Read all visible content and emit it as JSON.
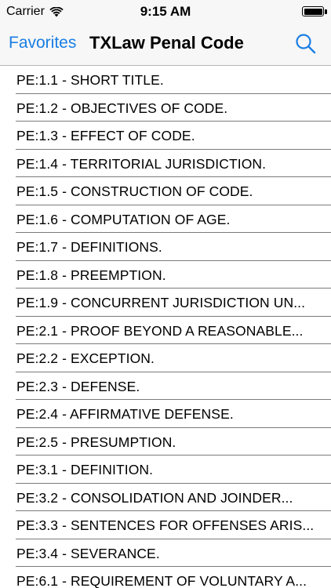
{
  "status_bar": {
    "carrier": "Carrier",
    "time": "9:15 AM",
    "wifi_icon": "wifi-icon",
    "battery_icon": "battery-icon"
  },
  "nav": {
    "back_label": "Favorites",
    "title": "TXLaw Penal Code",
    "search_icon": "search-icon",
    "accent_color": "#1a7ee3"
  },
  "list": {
    "items": [
      {
        "label": "PE:1.1 - SHORT TITLE."
      },
      {
        "label": "PE:1.2 - OBJECTIVES OF CODE."
      },
      {
        "label": "PE:1.3 - EFFECT OF CODE."
      },
      {
        "label": "PE:1.4 - TERRITORIAL JURISDICTION."
      },
      {
        "label": "PE:1.5 - CONSTRUCTION OF CODE."
      },
      {
        "label": "PE:1.6 - COMPUTATION OF AGE."
      },
      {
        "label": "PE:1.7 - DEFINITIONS."
      },
      {
        "label": "PE:1.8 - PREEMPTION."
      },
      {
        "label": "PE:1.9 - CONCURRENT JURISDICTION UN..."
      },
      {
        "label": "PE:2.1 - PROOF BEYOND A REASONABLE..."
      },
      {
        "label": "PE:2.2 - EXCEPTION."
      },
      {
        "label": "PE:2.3 - DEFENSE."
      },
      {
        "label": "PE:2.4 - AFFIRMATIVE DEFENSE."
      },
      {
        "label": "PE:2.5 - PRESUMPTION."
      },
      {
        "label": "PE:3.1 - DEFINITION."
      },
      {
        "label": "PE:3.2 - CONSOLIDATION AND JOINDER..."
      },
      {
        "label": "PE:3.3 - SENTENCES FOR OFFENSES ARIS..."
      },
      {
        "label": "PE:3.4 - SEVERANCE."
      },
      {
        "label": "PE:6.1 - REQUIREMENT OF VOLUNTARY A..."
      }
    ]
  }
}
